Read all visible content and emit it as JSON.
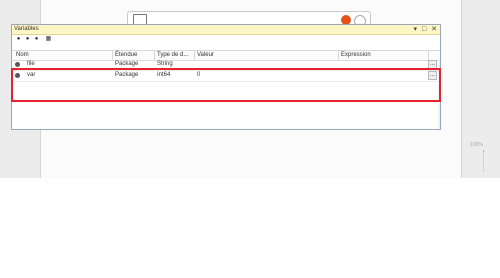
{
  "panel": {
    "title": "Variables",
    "controls": {
      "pin": "▾",
      "restore": "□",
      "close": "✕"
    }
  },
  "toolbar": [
    {
      "icon": "add-variable-icon",
      "glyph": "●"
    },
    {
      "icon": "add-shared-variable-icon",
      "glyph": "●"
    },
    {
      "icon": "add-group-icon",
      "glyph": "●"
    },
    {
      "icon": "grid-view-icon",
      "glyph": "▦"
    }
  ],
  "columns": {
    "name": "Nom",
    "scope": "Étendue",
    "type": "Type de d...",
    "value": "Valeur",
    "expression": "Expression"
  },
  "rows": [
    {
      "name": "file",
      "scope": "Package",
      "type": "String",
      "value": "",
      "expr_button": "..."
    },
    {
      "name": "var",
      "scope": "Package",
      "type": "Int64",
      "value": "0",
      "expr_button": "..."
    }
  ],
  "background": {
    "zoom_label": "100%"
  }
}
